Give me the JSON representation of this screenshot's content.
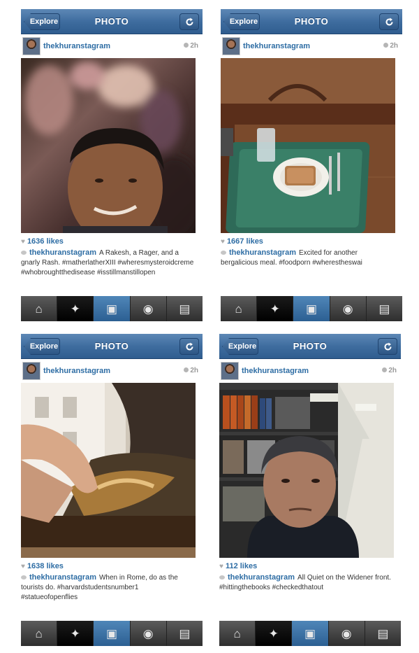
{
  "common": {
    "explore_label": "Explore",
    "title": "PHOTO"
  },
  "screens": [
    {
      "username": "thekhuranstagram",
      "time": "2h",
      "likes": "1636 likes",
      "caption_user": "thekhuranstagram",
      "caption_text": "A Rakesh, a Rager, and a gnarly Rash. #matherlatherXIII #wheresmysteroidcreme #whobroughtthedisease #isstillmanstillopen"
    },
    {
      "username": "thekhuranstagram",
      "time": "2h",
      "likes": "1667 likes",
      "caption_user": "thekhuranstagram",
      "caption_text": "Excited for another bergalicious meal. #foodporn #wherestheswai"
    },
    {
      "username": "thekhuranstagram",
      "time": "2h",
      "likes": "1638 likes",
      "caption_user": "thekhuranstagram",
      "caption_text": "When in Rome, do as the tourists do. #harvardstudentsnumber1 #statueofopenflies"
    },
    {
      "username": "thekhuranstagram",
      "time": "2h",
      "likes": "112 likes",
      "caption_user": "thekhuranstagram",
      "caption_text": "All Quiet on the Widener front. #hittingthebooks #checkedthatout"
    }
  ],
  "tabs": [
    "home-icon",
    "explore-star-icon",
    "camera-icon",
    "news-bubble-icon",
    "profile-card-icon"
  ],
  "colors": {
    "header_blue": "#3f6d9f",
    "link_blue": "#2e6da4",
    "tabbar_dark": "#2e2e2e",
    "active_tab_blue": "#2c5f92"
  }
}
